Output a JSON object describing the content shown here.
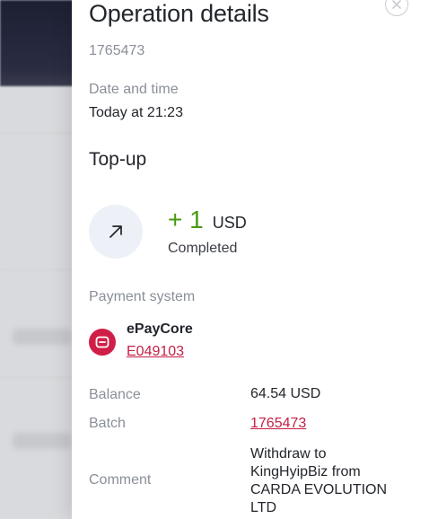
{
  "panel": {
    "title": "Operation details",
    "operation_id": "1765473",
    "date_label": "Date and time",
    "date_value": "Today at 21:23",
    "operation_type": "Top-up",
    "amount": "+ 1",
    "currency": "USD",
    "status": "Completed",
    "payment_system_label": "Payment system",
    "payment_system_name": "ePayCore",
    "payment_account": "E049103",
    "balance_label": "Balance",
    "balance_value": "64.54 USD",
    "batch_label": "Batch",
    "batch_value": "1765473",
    "comment_label": "Comment",
    "comment_value": "Withdraw to KingHyipBiz from CARDA EVOLUTION LTD"
  },
  "icons": {
    "close": "close-icon",
    "arrow": "arrow-up-right-icon",
    "logo": "epaycore-logo-icon"
  },
  "colors": {
    "amount_positive": "#4a9a12",
    "link": "#c41f45",
    "brand_logo": "#cf1f47",
    "muted_text": "#8a8f98"
  }
}
